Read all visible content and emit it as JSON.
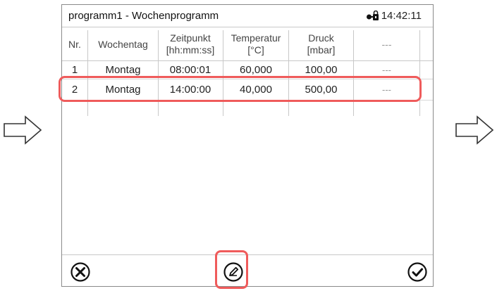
{
  "window": {
    "title": "programm1 - Wochenprogramm",
    "time": "14:42:11"
  },
  "table": {
    "headers": [
      {
        "line1": "Nr.",
        "line2": ""
      },
      {
        "line1": "Wochentag",
        "line2": ""
      },
      {
        "line1": "Zeitpunkt",
        "line2": "[hh:mm:ss]"
      },
      {
        "line1": "Temperatur",
        "line2": "[°C]"
      },
      {
        "line1": "Druck",
        "line2": "[mbar]"
      },
      {
        "line1": "---",
        "line2": ""
      }
    ],
    "rows": [
      {
        "nr": "1",
        "wochentag": "Montag",
        "zeitpunkt": "08:00:01",
        "temperatur": "60,000",
        "druck": "100,00",
        "extra": "---"
      },
      {
        "nr": "2",
        "wochentag": "Montag",
        "zeitpunkt": "14:00:00",
        "temperatur": "40,000",
        "druck": "500,00",
        "extra": "---"
      }
    ],
    "highlighted_row": 2
  },
  "footer": {
    "cancel_icon": "cancel-circle-icon",
    "edit_icon": "edit-pencil-icon",
    "confirm_icon": "confirm-check-icon"
  },
  "colors": {
    "highlight": "#ef5b5b",
    "border": "#8a8a8a",
    "grid": "#c8c8c8"
  }
}
